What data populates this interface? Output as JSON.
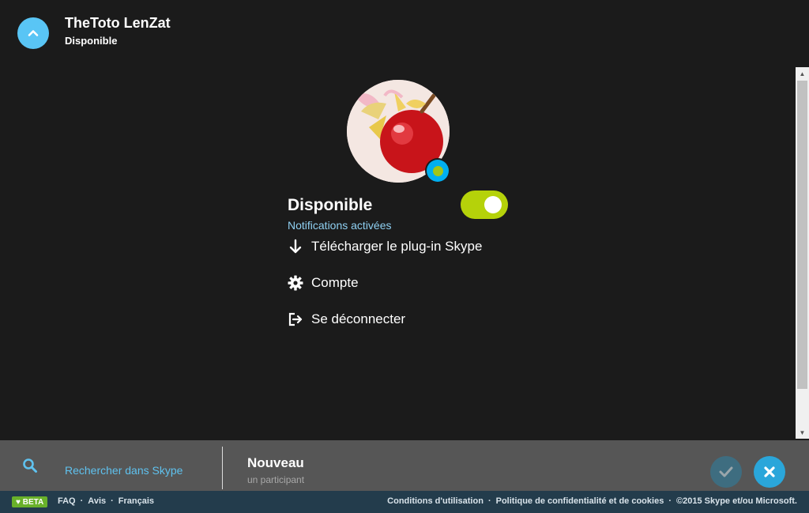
{
  "header": {
    "name": "TheToto LenZat",
    "status": "Disponible",
    "collapse_icon": "chevron-up-icon"
  },
  "profile": {
    "status_title": "Disponible",
    "notifications": "Notifications activées",
    "notifications_enabled": true,
    "presence_color": "#a2c617"
  },
  "menu": [
    {
      "label": "Télécharger le plug-in Skype",
      "icon": "download-icon"
    },
    {
      "label": "Compte",
      "icon": "gear-icon"
    },
    {
      "label": "Se déconnecter",
      "icon": "sign-out-icon"
    }
  ],
  "bottombar": {
    "search_label": "Rechercher dans Skype",
    "new_title": "Nouveau",
    "new_sub": "un participant"
  },
  "footer": {
    "beta": "♥ BETA",
    "left_links": [
      "FAQ",
      "Avis",
      "Français"
    ],
    "right_links": [
      "Conditions d'utilisation",
      "Politique de confidentialité et de cookies",
      "©2015 Skype et/ou Microsoft."
    ]
  },
  "colors": {
    "accent": "#59c5f5",
    "toggle": "#b5d20a",
    "footer": "#233c4c"
  }
}
